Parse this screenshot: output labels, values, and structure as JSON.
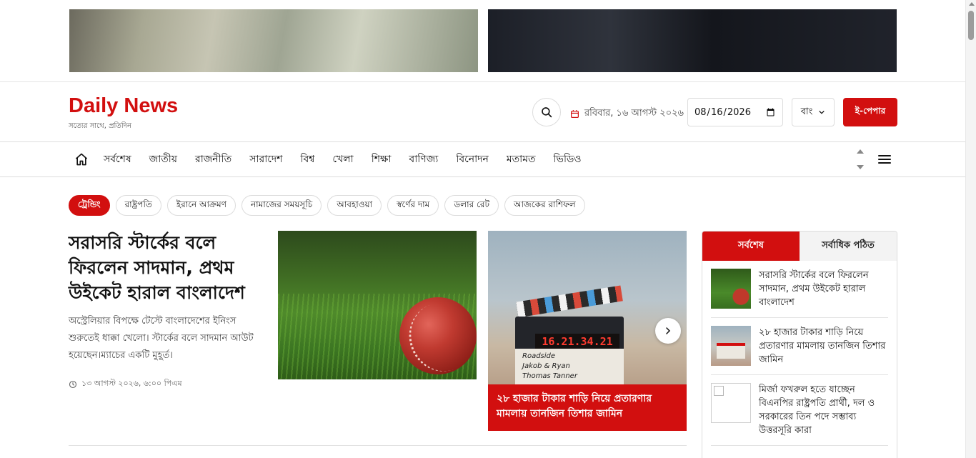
{
  "ads": {
    "left_name": "money-banner-ad",
    "right_name": "car-banner-ad"
  },
  "header": {
    "logo": "Daily News",
    "tagline": "সত্যের সাথে, প্রতিদিন",
    "date_text": "রবিবার, ১৬ আগস্ট ২০২৬",
    "date_value": "2026-08-16",
    "language": "বাং",
    "epaper": "ই-পেপার"
  },
  "nav": {
    "items": [
      "সর্বশেষ",
      "জাতীয়",
      "রাজনীতি",
      "সারাদেশ",
      "বিশ্ব",
      "খেলা",
      "শিক্ষা",
      "বাণিজ্য",
      "বিনোদন",
      "মতামত",
      "ভিডিও"
    ]
  },
  "trending": {
    "label": "ট্রেন্ডিং",
    "tags": [
      "রাষ্ট্রপতি",
      "ইরানে আক্রমণ",
      "নামাজের সময়সূচি",
      "আবহাওয়া",
      "স্বর্ণের দাম",
      "ডলার রেট",
      "আজকের রাশিফল"
    ]
  },
  "lead": {
    "title": "সরাসরি স্টার্কের বলে ফিরলেন সাদমান, প্রথম উইকেট হারাল বাংলাদেশ",
    "summary": "অস্ট্রেলিয়ার বিপক্ষে টেস্টে বাংলাদেশের ইনিংস শুরুতেই ধাক্কা খেলো। স্টার্কের বলে সাদমান আউট হয়েছেন।ম্যাচের একটি মুহূর্ত।",
    "time": "১৩ আগস্ট ২০২৬, ৬:০০ পিএম"
  },
  "slider": {
    "caption": "২৮ হাজার টাকার শাড়ি নিয়ে প্রতারণার মামলায় তানজিন তিশার জামিন",
    "clapper_digits": "16.21.34.21",
    "clapper_line1": "Roadside",
    "clapper_line2": "Jakob & Ryan",
    "clapper_line3": "Thomas Tanner"
  },
  "sidebar": {
    "tabs": [
      "সর্বশেষ",
      "সর্বাধিক পঠিত"
    ],
    "active_tab": 0,
    "items": [
      {
        "title": "সরাসরি স্টার্কের বলে ফিরলেন সাদমান, প্রথম উইকেট হারাল বাংলাদেশ",
        "thumb": "cricket"
      },
      {
        "title": "২৮ হাজার টাকার শাড়ি নিয়ে প্রতারণার মামলায় তানজিন তিশার জামিন",
        "thumb": "saree"
      },
      {
        "title": "মির্জা ফখরুল হতে যাচ্ছেন বিএনপির রাষ্ট্রপতি প্রার্থী, দল ও সরকারের তিন পদে সম্ভাব্য উত্তরসূরি কারা",
        "thumb": "broken"
      }
    ]
  },
  "colors": {
    "brand": "#d20f0f",
    "text": "#111111",
    "muted": "#666666",
    "border": "#dcdcdc"
  }
}
